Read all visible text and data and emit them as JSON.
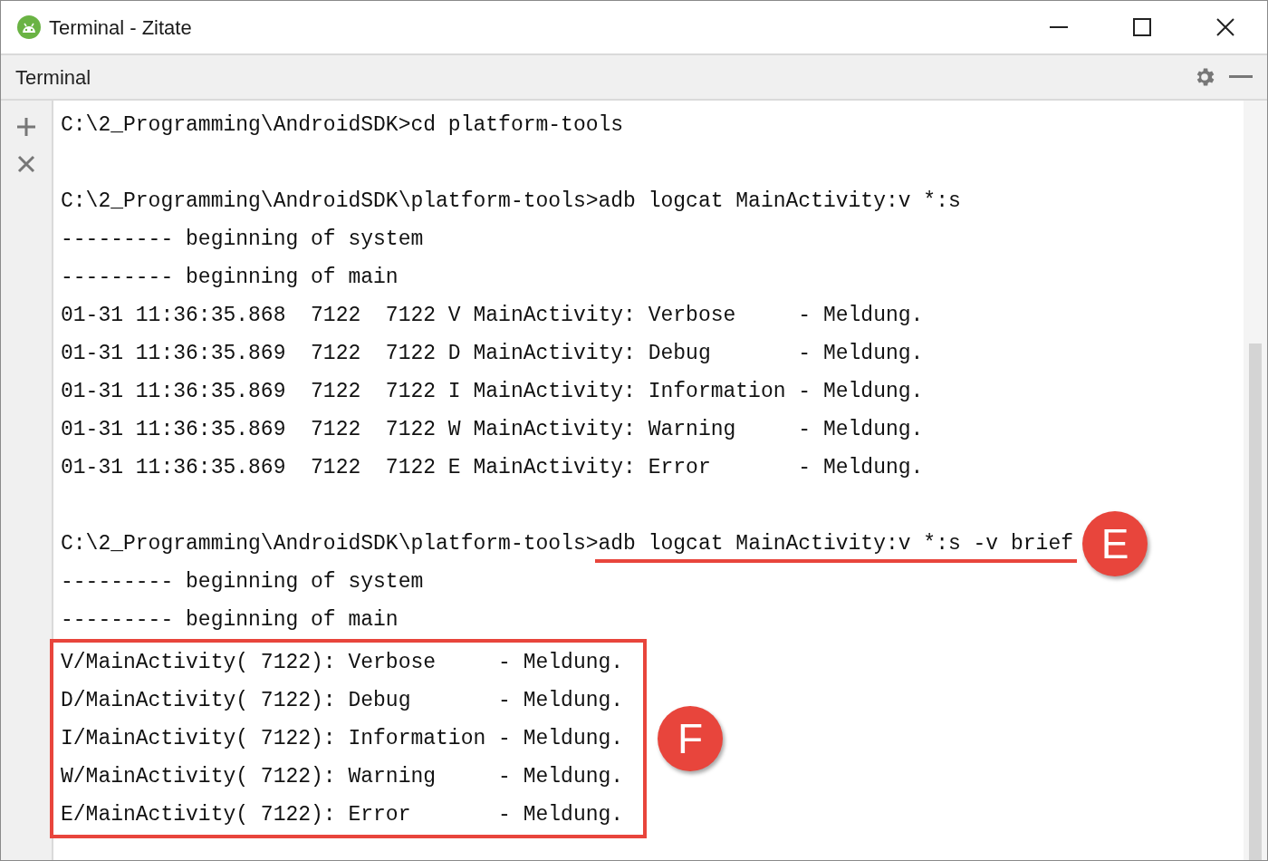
{
  "window": {
    "title": "Terminal - Zitate"
  },
  "panel": {
    "title": "Terminal"
  },
  "terminal": {
    "lines": [
      {
        "kind": "text",
        "text": "C:\\2_Programming\\AndroidSDK>cd platform-tools"
      },
      {
        "kind": "blank"
      },
      {
        "kind": "text",
        "text": "C:\\2_Programming\\AndroidSDK\\platform-tools>adb logcat MainActivity:v *:s"
      },
      {
        "kind": "text",
        "text": "--------- beginning of system"
      },
      {
        "kind": "text",
        "text": "--------- beginning of main"
      },
      {
        "kind": "text",
        "text": "01-31 11:36:35.868  7122  7122 V MainActivity: Verbose     - Meldung."
      },
      {
        "kind": "text",
        "text": "01-31 11:36:35.869  7122  7122 D MainActivity: Debug       - Meldung."
      },
      {
        "kind": "text",
        "text": "01-31 11:36:35.869  7122  7122 I MainActivity: Information - Meldung."
      },
      {
        "kind": "text",
        "text": "01-31 11:36:35.869  7122  7122 W MainActivity: Warning     - Meldung."
      },
      {
        "kind": "text",
        "text": "01-31 11:36:35.869  7122  7122 E MainActivity: Error       - Meldung."
      },
      {
        "kind": "blank"
      },
      {
        "kind": "underlined",
        "prompt": "C:\\2_Programming\\AndroidSDK\\platform-tools>",
        "command": "adb logcat MainActivity:v *:s -v brief",
        "marker": "E"
      },
      {
        "kind": "text",
        "text": "--------- beginning of system"
      },
      {
        "kind": "text",
        "text": "--------- beginning of main"
      },
      {
        "kind": "boxed",
        "marker": "F",
        "lines": [
          "V/MainActivity( 7122): Verbose     - Meldung.",
          "D/MainActivity( 7122): Debug       - Meldung.",
          "I/MainActivity( 7122): Information - Meldung.",
          "W/MainActivity( 7122): Warning     - Meldung.",
          "E/MainActivity( 7122): Error       - Meldung."
        ]
      }
    ]
  }
}
